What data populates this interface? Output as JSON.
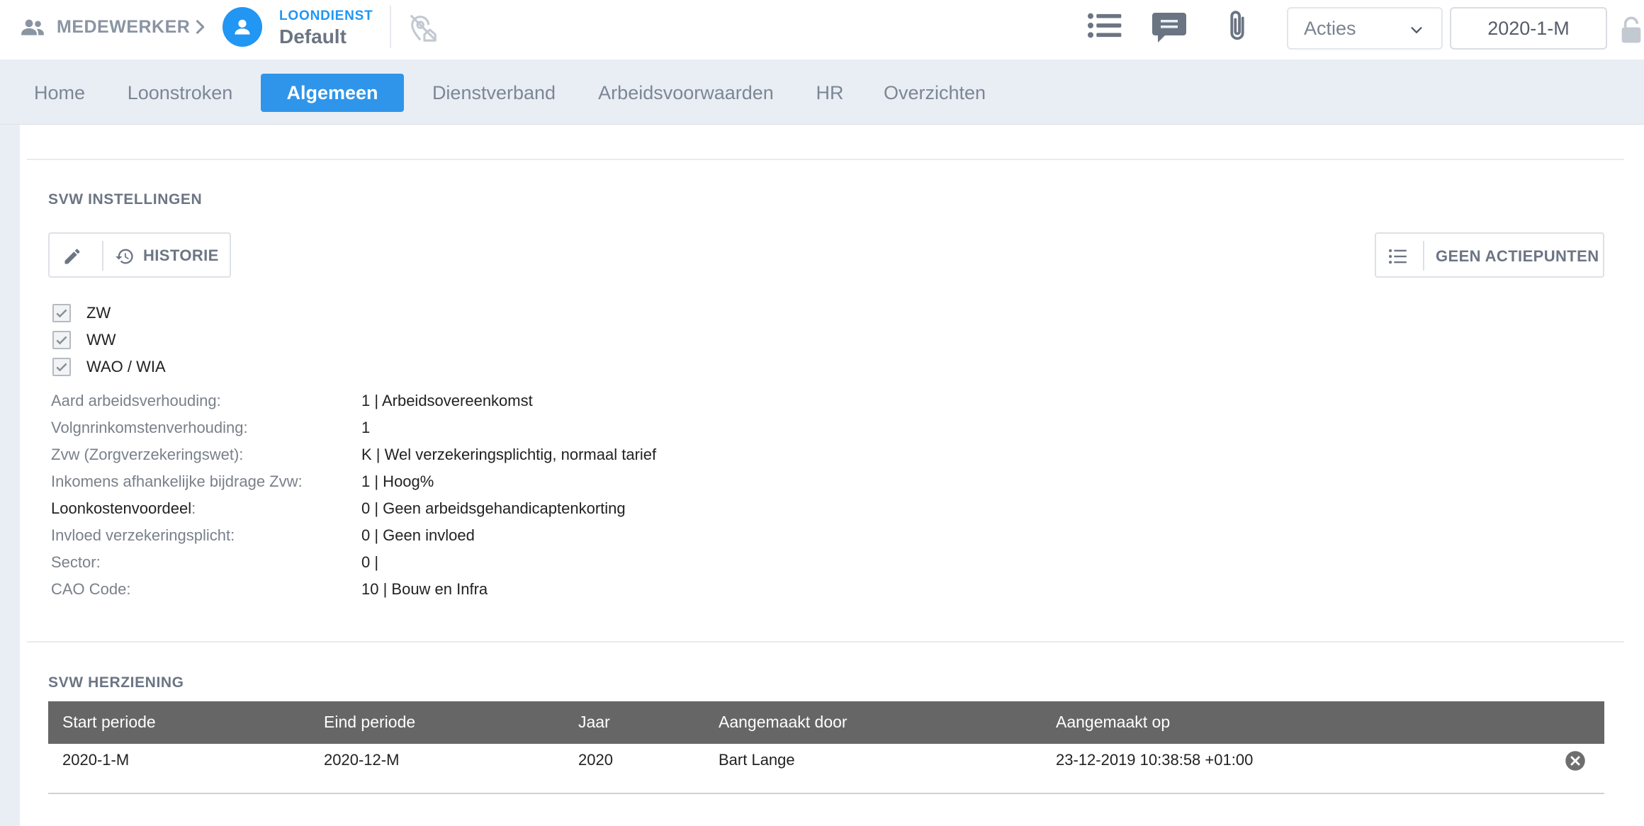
{
  "topbar": {
    "employee_label": "MEDEWERKER",
    "loondienst_small": "LOONDIENST",
    "loondienst_name": "Default",
    "acties_label": "Acties",
    "period": "2020-1-M"
  },
  "nav": {
    "tabs": [
      "Home",
      "Loonstroken",
      "Algemeen",
      "Dienstverband",
      "Arbeidsvoorwaarden",
      "HR",
      "Overzichten"
    ],
    "active": "Algemeen"
  },
  "svw_instellingen": {
    "title": "SVW INSTELLINGEN",
    "historie_label": "HISTORIE",
    "actiepunten_label": "GEEN ACTIEPUNTEN",
    "checkboxes": [
      {
        "label": "ZW",
        "checked": true
      },
      {
        "label": "WW",
        "checked": true
      },
      {
        "label": "WAO / WIA",
        "checked": true
      }
    ],
    "fields": [
      {
        "label": "Aard arbeidsverhouding:",
        "value": "1 | Arbeidsovereenkomst"
      },
      {
        "label": "Volgnrinkomstenverhouding:",
        "value": "1"
      },
      {
        "label": "Zvw (Zorgverzekeringswet):",
        "value": "K | Wel verzekeringsplichtig, normaal tarief"
      },
      {
        "label": "Inkomens afhankelijke bijdrage Zvw:",
        "value": "1 | Hoog%"
      },
      {
        "label": "Loonkostenvoordeel",
        "value": "0 | Geen arbeidsgehandicaptenkorting"
      },
      {
        "label": "Invloed verzekeringsplicht:",
        "value": "0 | Geen invloed"
      },
      {
        "label": "Sector:",
        "value": "0 |"
      },
      {
        "label": "CAO Code:",
        "value": "10 | Bouw en Infra"
      }
    ]
  },
  "svw_herziening": {
    "title": "SVW HERZIENING",
    "columns": [
      "Start periode",
      "Eind periode",
      "Jaar",
      "Aangemaakt door",
      "Aangemaakt op"
    ],
    "rows": [
      {
        "start": "2020-1-M",
        "eind": "2020-12-M",
        "jaar": "2020",
        "door": "Bart Lange",
        "op": "23-12-2019 10:38:58 +01:00"
      }
    ]
  },
  "colors": {
    "accent": "#2f95ea",
    "nav_bg": "#e9eef5",
    "table_header": "#666666"
  }
}
